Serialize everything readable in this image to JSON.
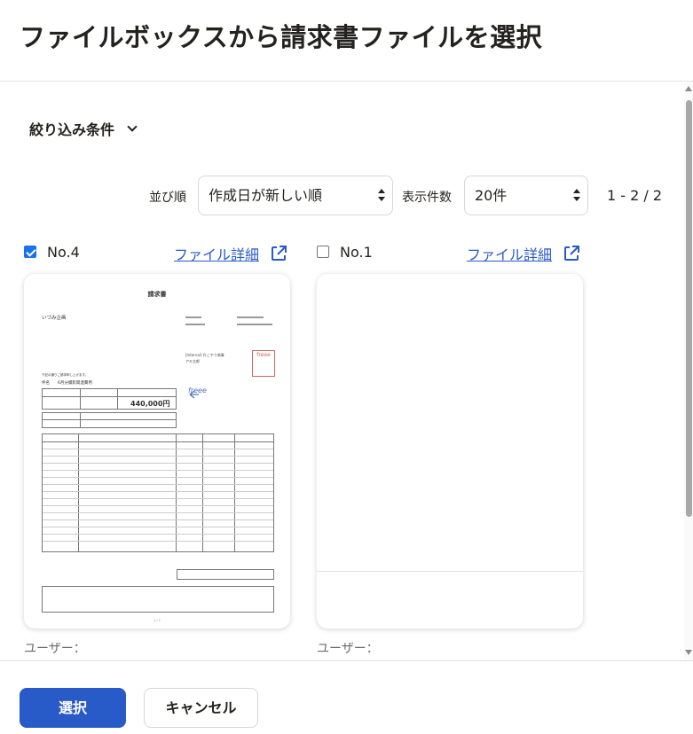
{
  "dialog": {
    "title": "ファイルボックスから請求書ファイルを選択"
  },
  "filter": {
    "label": "絞り込み条件"
  },
  "sort": {
    "label": "並び順",
    "selected": "作成日が新しい順"
  },
  "count": {
    "label": "表示件数",
    "selected": "20件"
  },
  "pagination": {
    "text": "1 - 2 / 2"
  },
  "cards": [
    {
      "number": "No.4",
      "checked": true,
      "detail_link": "ファイル詳細",
      "user_label": "ユーザー："
    },
    {
      "number": "No.1",
      "checked": false,
      "detail_link": "ファイル詳細",
      "user_label": "ユーザー："
    }
  ],
  "invoice_preview": {
    "title": "請求書",
    "to": "いづみ企画",
    "from_line1": "[Internal] れこやう商事",
    "from_line2": "アキ太郎",
    "greeting": "下記の通りご請求申し上げます。",
    "subject": "件名　　6月分撮影関連費用",
    "amount": "440,000円",
    "logo": "freee",
    "seal": "freee",
    "page": "1 / 1"
  },
  "footer": {
    "select_label": "選択",
    "cancel_label": "キャンセル"
  },
  "colors": {
    "primary": "#285ac8",
    "link": "#285ac8",
    "text": "#23221f",
    "checkbox": "#1a73e8"
  }
}
